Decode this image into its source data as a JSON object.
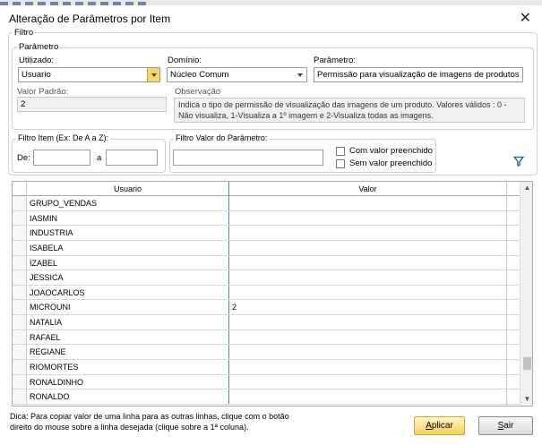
{
  "window": {
    "title": "Alteração de Parâmetros por Item",
    "close_glyph": "✕"
  },
  "filtro": {
    "legend": "Filtro",
    "parametro_legend": "Parâmetro",
    "utilizado": {
      "label": "Utilizado:",
      "value": "Usuario"
    },
    "dominio": {
      "label": "Domínio:",
      "value": "Núcleo Comum"
    },
    "parametro": {
      "label": "Parâmetro:",
      "value": "Permissão para visualização de imagens de produtos"
    },
    "valor_padrao": {
      "label": "Valor Padrão:",
      "value": "2"
    },
    "observacao": {
      "label": "Observação",
      "value": "Indica o tipo de permissão de visualização das imagens de um produto. Valores válidos : 0 -Não visualiza, 1-Visualiza a 1º imagem e 2-Visualiza todas as imagens."
    },
    "filtro_item": {
      "legend": "Filtro Item (Ex: De A a Z):",
      "de_label": "De:",
      "a_label": "a",
      "de_value": "",
      "a_value": ""
    },
    "filtro_valor": {
      "legend": "Filtro Valor do Parâmetro:",
      "value": "",
      "com_valor": "Com valor preenchido",
      "sem_valor": "Sem valor preenchido"
    },
    "filter_icon": "funnel-icon"
  },
  "grid": {
    "columns": [
      "Usuario",
      "Valor"
    ],
    "rows": [
      {
        "usuario": "GRUPO_VENDAS",
        "valor": ""
      },
      {
        "usuario": "IASMIN",
        "valor": ""
      },
      {
        "usuario": "INDUSTRIA",
        "valor": ""
      },
      {
        "usuario": "ISABELA",
        "valor": ""
      },
      {
        "usuario": "IZABEL",
        "valor": ""
      },
      {
        "usuario": "JESSICA",
        "valor": ""
      },
      {
        "usuario": "JOAOCARLOS",
        "valor": ""
      },
      {
        "usuario": "MICROUNI",
        "valor": "2"
      },
      {
        "usuario": "NATALIA",
        "valor": ""
      },
      {
        "usuario": "RAFAEL",
        "valor": ""
      },
      {
        "usuario": "REGIANE",
        "valor": ""
      },
      {
        "usuario": "RIOMORTES",
        "valor": ""
      },
      {
        "usuario": "RONALDINHO",
        "valor": ""
      },
      {
        "usuario": "RONALDO",
        "valor": ""
      }
    ]
  },
  "footer": {
    "tip_line1": "Dica: Para copiar valor de uma linha para as outras linhas, clique com o botão",
    "tip_line2": "direito do mouse sobre a linha desejada (clique sobre a 1ª coluna).",
    "aplicar_prefix": "",
    "aplicar_underlined": "A",
    "aplicar_rest": "plicar",
    "sair_prefix": "",
    "sair_underlined": "S",
    "sair_rest": "air"
  }
}
